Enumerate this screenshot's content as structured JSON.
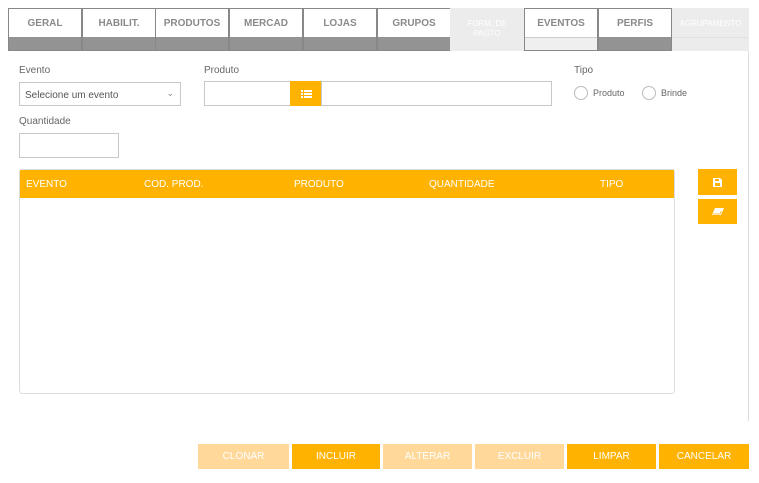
{
  "tabs": [
    {
      "label": "GERAL"
    },
    {
      "label": "HABILIT."
    },
    {
      "label": "PRODUTOS"
    },
    {
      "label": "MERCAD"
    },
    {
      "label": "LOJAS"
    },
    {
      "label": "GRUPOS"
    },
    {
      "label": "FORM. DE PAGTO"
    },
    {
      "label": "EVENTOS"
    },
    {
      "label": "PERFIS"
    },
    {
      "label": "AGRUPAMENTO"
    }
  ],
  "form": {
    "evento_label": "Evento",
    "evento_value": "Selecione um evento",
    "produto_label": "Produto",
    "produto_code": "",
    "produto_desc": "",
    "tipo_label": "Tipo",
    "tipo_options": [
      "Produto",
      "Brinde"
    ],
    "quantidade_label": "Quantidade",
    "quantidade_value": ""
  },
  "table": {
    "columns": [
      "EVENTO",
      "COD. PROD.",
      "PRODUTO",
      "QUANTIDADE",
      "TIPO"
    ],
    "rows": []
  },
  "actions": [
    "CLONAR",
    "INCLUIR",
    "ALTERAR",
    "EXCLUIR",
    "LIMPAR",
    "CANCELAR"
  ],
  "colors": {
    "accent": "#FFB300",
    "accent_disabled": "#FFD89A"
  }
}
